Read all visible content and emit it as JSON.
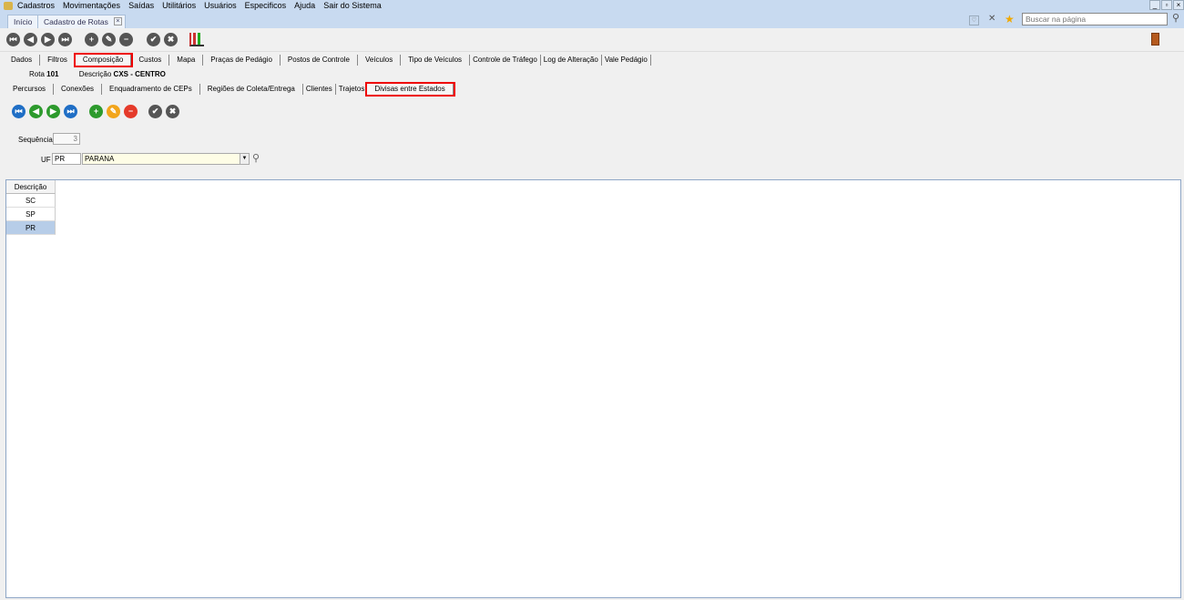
{
  "menu": [
    "Cadastros",
    "Movimentações",
    "Saídas",
    "Utilitários",
    "Usuários",
    "Especificos",
    "Ajuda",
    "Sair do Sistema"
  ],
  "doc_tabs": {
    "home": "Início",
    "active": "Cadastro de Rotas"
  },
  "search": {
    "placeholder": "Buscar na página"
  },
  "main_tabs": [
    "Dados",
    "Filtros",
    "Composição",
    "Custos",
    "Mapa",
    "Praças de Pedágio",
    "Postos de Controle",
    "Veículos",
    "Tipo de Veículos",
    "Controle de Tráfego",
    "Log de Alteração",
    "Vale Pedágio"
  ],
  "info": {
    "rota_label": "Rota",
    "rota_value": "101",
    "desc_label": "Descrição",
    "desc_value": "CXS - CENTRO"
  },
  "sub_tabs": [
    "Percursos",
    "Conexões",
    "Enquadramento de CEPs",
    "Regiões de Coleta/Entrega",
    "Clientes",
    "Trajetos",
    "Divisas entre Estados"
  ],
  "form": {
    "seq_label": "Sequência",
    "seq_value": "3",
    "uf_label": "UF",
    "uf_code": "PR",
    "uf_name": "PARANA"
  },
  "grid": {
    "header": "Descrição",
    "rows": [
      "SC",
      "SP",
      "PR"
    ]
  }
}
